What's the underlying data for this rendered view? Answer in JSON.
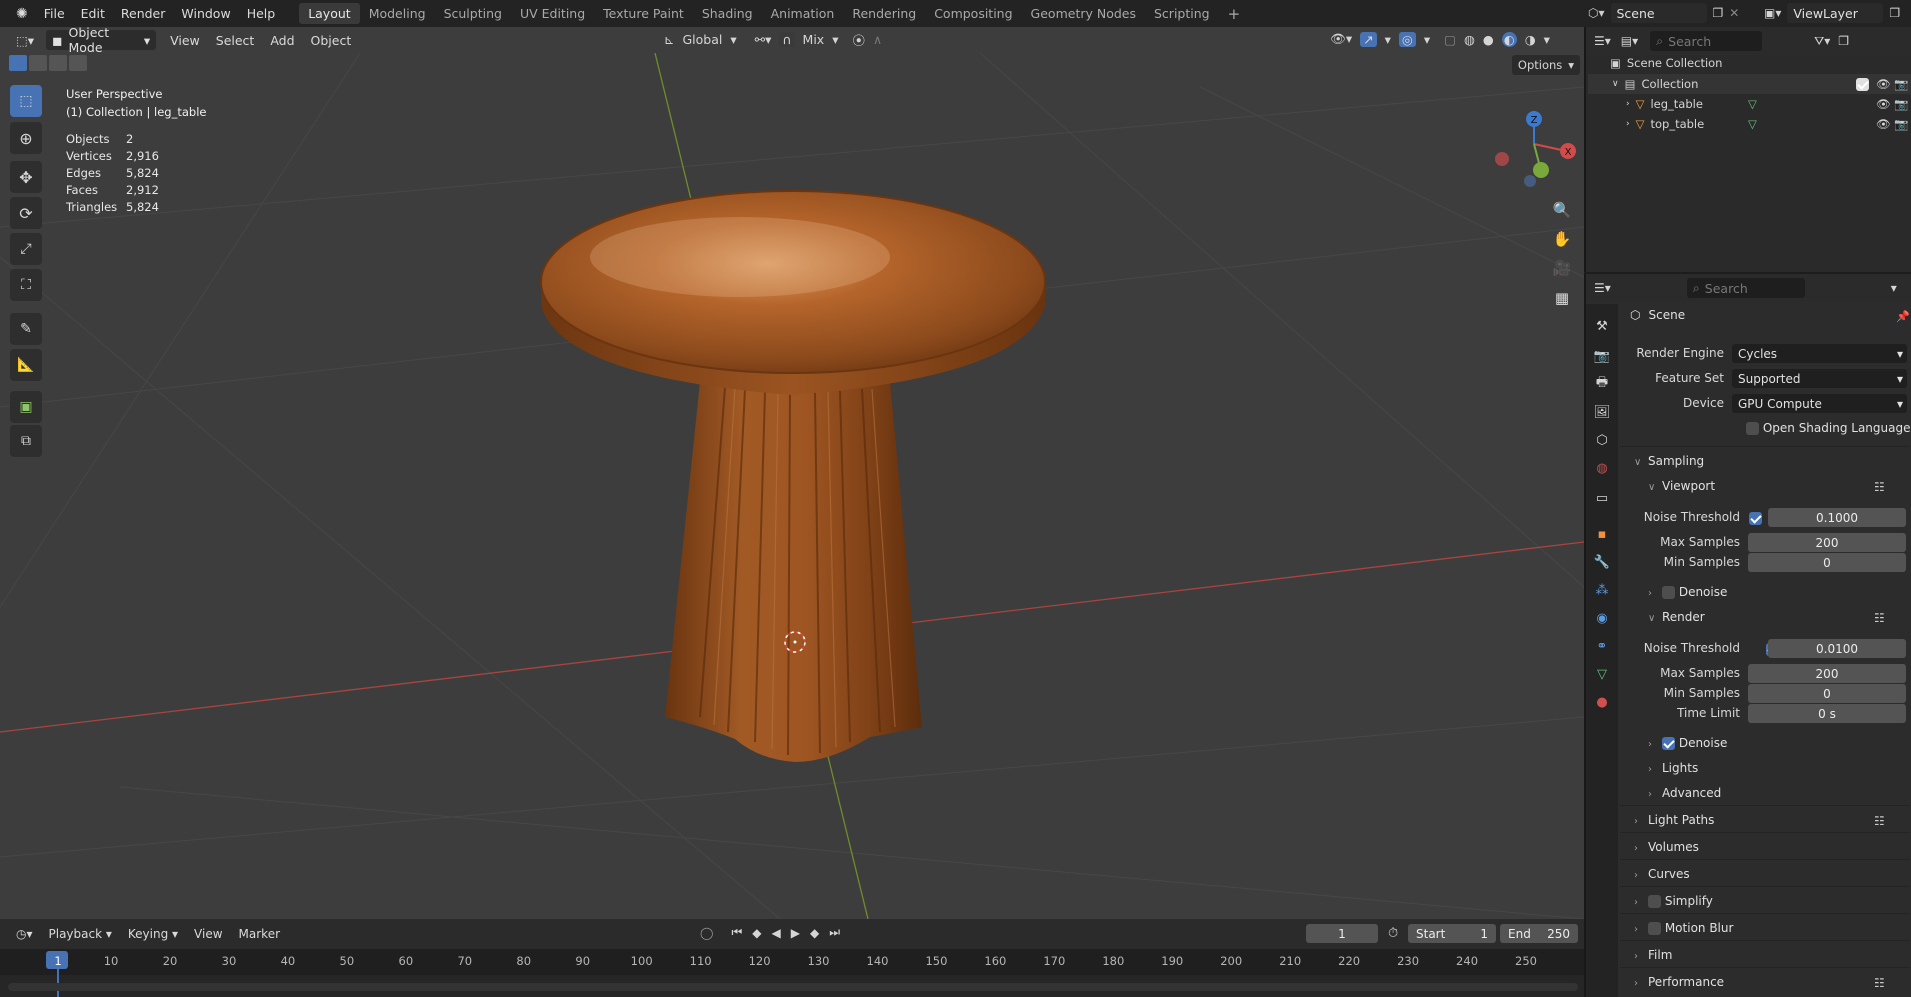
{
  "menu": [
    "File",
    "Edit",
    "Render",
    "Window",
    "Help"
  ],
  "workspaces": [
    {
      "label": "Layout",
      "active": true
    },
    {
      "label": "Modeling",
      "active": false
    },
    {
      "label": "Sculpting",
      "active": false
    },
    {
      "label": "UV Editing",
      "active": false
    },
    {
      "label": "Texture Paint",
      "active": false
    },
    {
      "label": "Shading",
      "active": false
    },
    {
      "label": "Animation",
      "active": false
    },
    {
      "label": "Rendering",
      "active": false
    },
    {
      "label": "Compositing",
      "active": false
    },
    {
      "label": "Geometry Nodes",
      "active": false
    },
    {
      "label": "Scripting",
      "active": false
    }
  ],
  "add_workspace": "+",
  "scene_name": "Scene",
  "view_layer": "ViewLayer",
  "viewport_header": {
    "mode": "Object Mode",
    "menus": [
      "View",
      "Select",
      "Add",
      "Object"
    ],
    "orientation": "Global",
    "snap_mode": "Mix",
    "options_label": "Options"
  },
  "overlay_info": {
    "perspective": "User Perspective",
    "collection_line": "(1) Collection | leg_table",
    "stats": [
      {
        "k": "Objects",
        "v": "2"
      },
      {
        "k": "Vertices",
        "v": "2,916"
      },
      {
        "k": "Edges",
        "v": "5,824"
      },
      {
        "k": "Faces",
        "v": "2,912"
      },
      {
        "k": "Triangles",
        "v": "5,824"
      }
    ]
  },
  "gizmo": {
    "z": "Z",
    "x": "X",
    "y": "Y"
  },
  "timeline": {
    "menus": [
      "Playback",
      "Keying",
      "View",
      "Marker"
    ],
    "current_frame": "1",
    "start_label": "Start",
    "start": "1",
    "end_label": "End",
    "end": "250",
    "ticks": [
      "1",
      "10",
      "20",
      "30",
      "40",
      "50",
      "60",
      "70",
      "80",
      "90",
      "100",
      "110",
      "120",
      "130",
      "140",
      "150",
      "160",
      "170",
      "180",
      "190",
      "200",
      "210",
      "220",
      "230",
      "240",
      "250"
    ]
  },
  "outliner": {
    "search_placeholder": "Search",
    "root": "Scene Collection",
    "collection": "Collection",
    "objects": [
      "leg_table",
      "top_table"
    ]
  },
  "properties": {
    "search_placeholder": "Search",
    "context": "Scene",
    "render_engine_label": "Render Engine",
    "render_engine": "Cycles",
    "feature_set_label": "Feature Set",
    "feature_set": "Supported",
    "device_label": "Device",
    "device": "GPU Compute",
    "osl_label": "Open Shading Language",
    "sampling": "Sampling",
    "viewport": "Viewport",
    "noise_threshold_label": "Noise Threshold",
    "vp_noise_threshold": "0.1000",
    "max_samples_label": "Max Samples",
    "vp_max_samples": "200",
    "min_samples_label": "Min Samples",
    "vp_min_samples": "0",
    "denoise": "Denoise",
    "render": "Render",
    "r_noise_threshold": "0.0100",
    "r_max_samples": "200",
    "r_min_samples": "0",
    "time_limit_label": "Time Limit",
    "r_time_limit": "0 s",
    "lights": "Lights",
    "advanced": "Advanced",
    "light_paths": "Light Paths",
    "volumes": "Volumes",
    "curves": "Curves",
    "simplify": "Simplify",
    "motion_blur": "Motion Blur",
    "film": "Film",
    "performance": "Performance"
  },
  "colors": {
    "accent": "#4772b3",
    "x_axis": "#c04545",
    "y_axis": "#7fa23a",
    "wood": "#8a4a1c"
  }
}
